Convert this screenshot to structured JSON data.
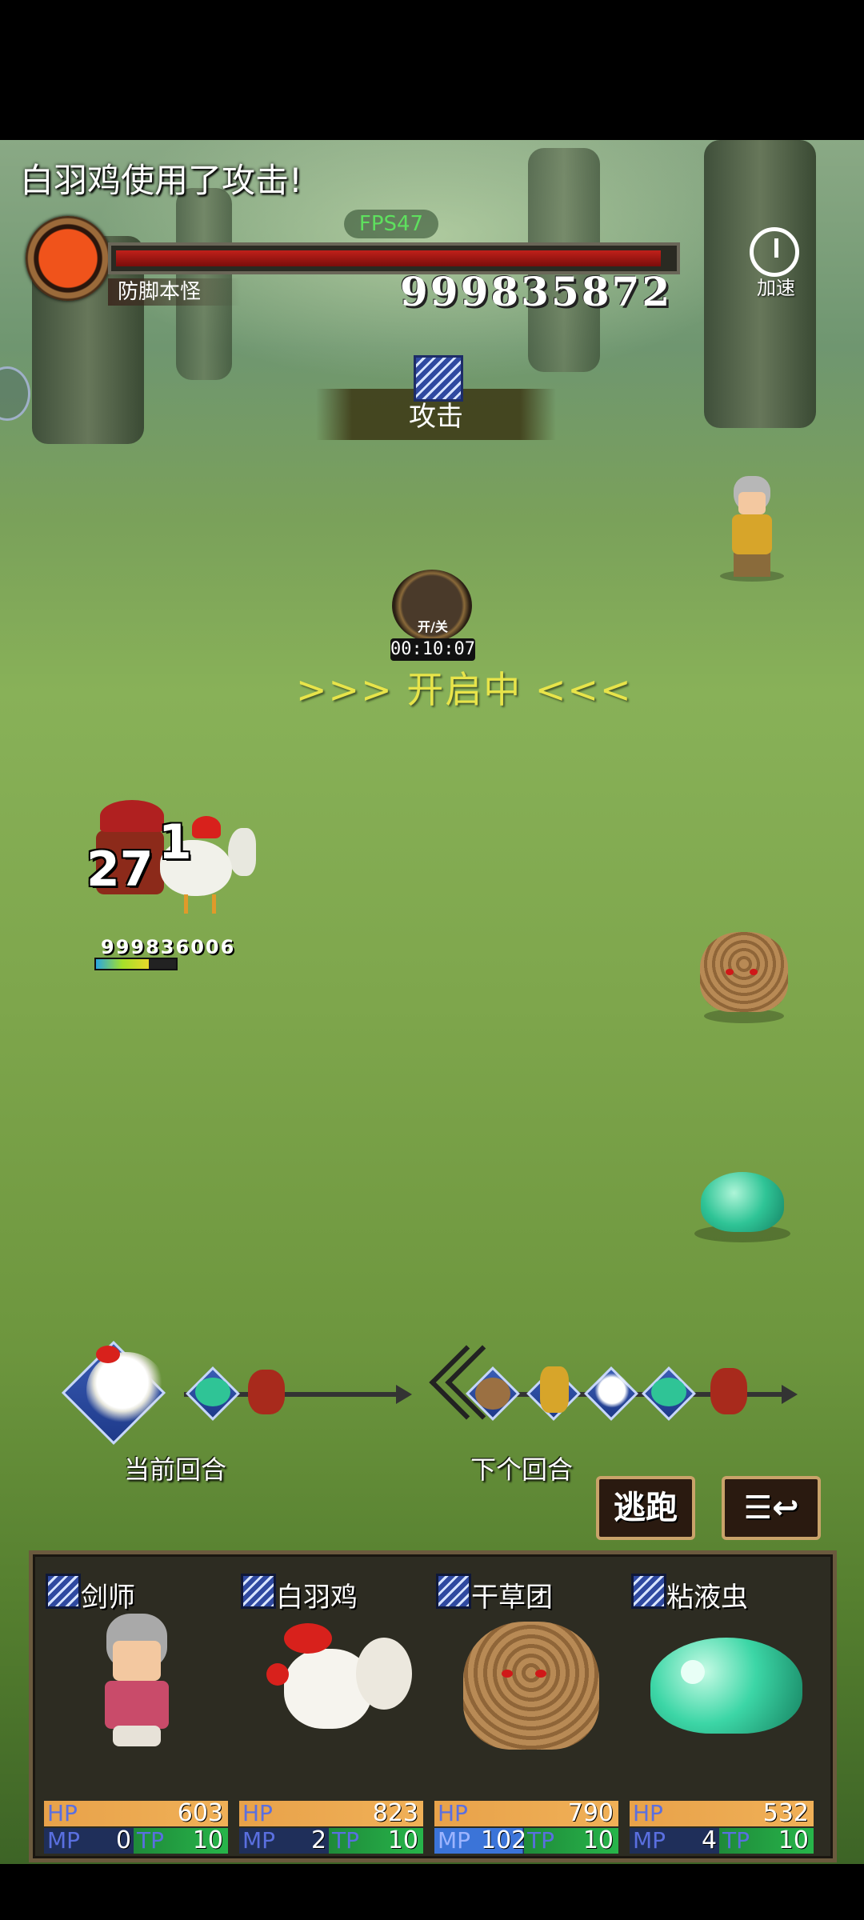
{
  "battle_log": "白羽鸡使用了攻击!",
  "fps": "FPS47",
  "boss": {
    "name": "防脚本怪",
    "hp": "999835872",
    "hp_fraction": 0.98
  },
  "speed_button": {
    "label": "加速",
    "icon": "stopwatch-icon"
  },
  "current_skill": {
    "label": "攻击",
    "icon": "slash-skill-icon"
  },
  "event": {
    "badge_label": "开/关",
    "timer": "00:10:07",
    "status": ">>>  开启中  <<<"
  },
  "field": {
    "damage_numbers": [
      "27",
      "1"
    ],
    "target_hp": "999836006",
    "target_hp_fraction": 0.66
  },
  "turn_order": {
    "current_label": "当前回合",
    "next_label": "下个回合",
    "current": [
      "rooster",
      "slime",
      "mage"
    ],
    "next": [
      "haystack",
      "swordsman",
      "rooster",
      "slime",
      "mage"
    ]
  },
  "actions": {
    "flee_label": "逃跑",
    "menu_icon": "list-toggle-icon"
  },
  "party": [
    {
      "name": "剑师",
      "hp": "603",
      "mp": "0",
      "tp": "10"
    },
    {
      "name": "白羽鸡",
      "hp": "823",
      "mp": "2",
      "tp": "10"
    },
    {
      "name": "干草团",
      "hp": "790",
      "mp": "102",
      "tp": "10"
    },
    {
      "name": "粘液虫",
      "hp": "532",
      "mp": "4",
      "tp": "10"
    }
  ],
  "stat_labels": {
    "hp": "HP",
    "mp": "MP",
    "tp": "TP"
  },
  "colors": {
    "status_yellow": "#e8e44a",
    "boss_red": "#c0201a",
    "fps_green": "#5ee05e"
  }
}
